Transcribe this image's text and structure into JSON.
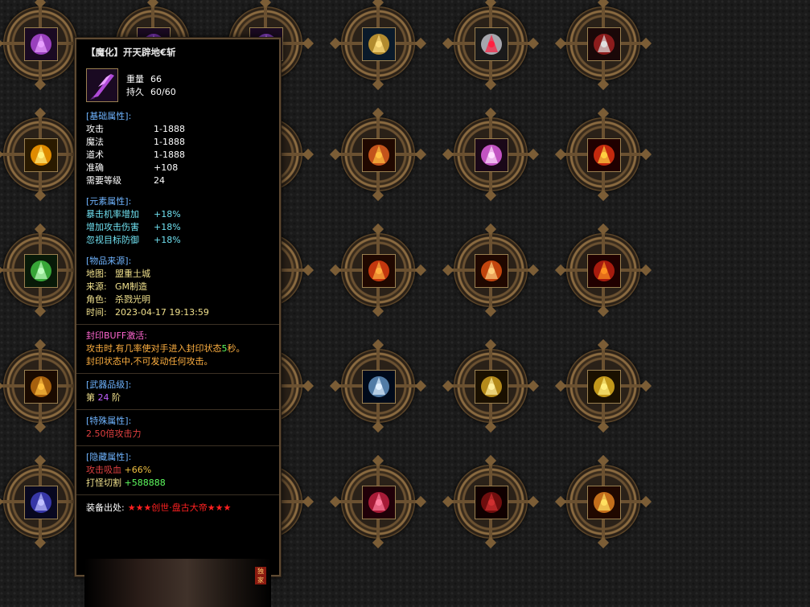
{
  "tooltip": {
    "title": "【魔化】开天辟地€斩",
    "weight_label": "重量",
    "weight_value": "66",
    "durability_label": "持久",
    "durability_value": "60/60",
    "basic_head": "[基础属性]:",
    "basic": [
      {
        "k": "攻击",
        "v": "1-1888"
      },
      {
        "k": "魔法",
        "v": "1-1888"
      },
      {
        "k": "道术",
        "v": "1-1888"
      },
      {
        "k": "准确",
        "v": "+108"
      },
      {
        "k": "需要等级",
        "v": "24"
      }
    ],
    "element_head": "[元素属性]:",
    "element": [
      {
        "k": "暴击机率增加",
        "v": "+18%"
      },
      {
        "k": "增加攻击伤害",
        "v": "+18%"
      },
      {
        "k": "忽视目标防御",
        "v": "+18%"
      }
    ],
    "origin_head": "[物品来源]:",
    "origin": [
      {
        "k": "地图:",
        "v": "盟重土城"
      },
      {
        "k": "来源:",
        "v": "GM制造"
      },
      {
        "k": "角色:",
        "v": "杀戮光明"
      },
      {
        "k": "时间:",
        "v": "2023-04-17 19:13:59"
      }
    ],
    "seal_head": "封印BUFF激活:",
    "seal_line1_a": "攻击时,有几率使对手进入封印状态",
    "seal_line1_num": "5",
    "seal_line1_b": "秒。",
    "seal_line2": "封印状态中,不可发动任何攻击。",
    "grade_head": "[武器品级]:",
    "grade_prefix": "第",
    "grade_num": "24",
    "grade_suffix": "阶",
    "special_head": "[特殊属性]:",
    "special_value": "2.50倍攻击力",
    "hidden_head": "[隐藏属性]:",
    "hidden": [
      {
        "k": "攻击吸血",
        "v": "+66%"
      },
      {
        "k": "打怪切割",
        "v": "+588888"
      }
    ],
    "source_label": "装备出处:",
    "source_value": "★★★创世·盘古大帝★★★",
    "art_tag": "独家"
  },
  "colors": {
    "section_head": "#6fb4ff",
    "element_value": "#6fe0f0",
    "origin_value": "#f0e08c",
    "seal": "#ff66d0",
    "grade_num": "#c060ff",
    "special": "#e04040",
    "source": "#ff2020"
  },
  "grid_icons": [
    "purple-blade-icon",
    "purple-axe-icon",
    "purple-gem-icon",
    "golden-bull-icon",
    "armored-boots-icon",
    "red-helmet-icon",
    "golden-ring-icon",
    "hidden-slot",
    "hidden-slot",
    "flame-sword-icon",
    "pink-orb-icon",
    "fire-emblem-icon",
    "green-mask-icon",
    "hidden-slot",
    "hidden-slot",
    "fire-arrow-icon",
    "flame-spear-icon",
    "fire-burst-icon",
    "golden-staff-icon",
    "hidden-slot",
    "hidden-slot",
    "blue-ring-icon",
    "golden-gun-icon",
    "golden-bag-icon",
    "dragon-eye-icon",
    "hidden-slot",
    "hidden-slot",
    "crimson-rose-icon",
    "red-armor-icon",
    "sun-emblem-icon"
  ]
}
